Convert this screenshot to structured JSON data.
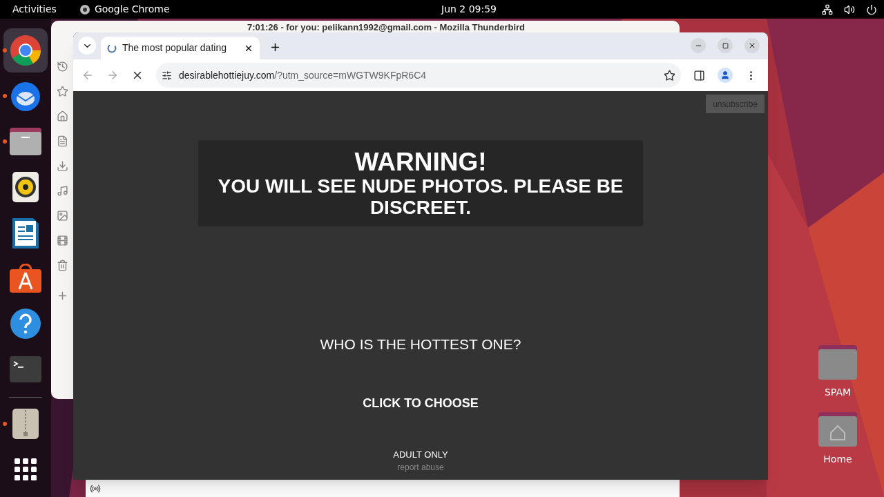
{
  "top_bar": {
    "activities": "Activities",
    "app_name": "Google Chrome",
    "clock": "Jun 2  09:59"
  },
  "dock": {
    "items": [
      {
        "kind": "chrome",
        "running": true,
        "active": true
      },
      {
        "kind": "thunderbird",
        "running": true,
        "active": false
      },
      {
        "kind": "files",
        "running": true,
        "active": false
      },
      {
        "kind": "rhythmbox",
        "running": false,
        "active": false
      },
      {
        "kind": "writer",
        "running": false,
        "active": false
      },
      {
        "kind": "software",
        "running": false,
        "active": false
      },
      {
        "kind": "help",
        "running": false,
        "active": false
      },
      {
        "kind": "terminal",
        "running": false,
        "active": false
      },
      {
        "kind": "archive",
        "running": true,
        "active": false
      },
      {
        "kind": "apps",
        "running": false,
        "active": false
      }
    ]
  },
  "background_window": {
    "title": "7:01:26 - for you: pelikann1992@gmail.com - Mozilla Thunderbird"
  },
  "browser": {
    "tab": {
      "title": "The most popular dating",
      "selected": true
    },
    "url_host": "desirablehottiejuy.com",
    "url_path": "/?utm_source=mWGTW9KFpR6C4",
    "page": {
      "unsubscribe": "unsubscribe",
      "warning_title": "WARNING!",
      "warning_text": "YOU WILL SEE NUDE PHOTOS. PLEASE BE DISCREET.",
      "question": "WHO IS THE HOTTEST ONE?",
      "cta": "CLICK TO CHOOSE",
      "adult_only": "ADULT ONLY",
      "report": "report abuse"
    }
  },
  "desktop_icons": [
    {
      "label": "SPAM",
      "kind": "folder"
    },
    {
      "label": "Home",
      "kind": "home"
    }
  ]
}
